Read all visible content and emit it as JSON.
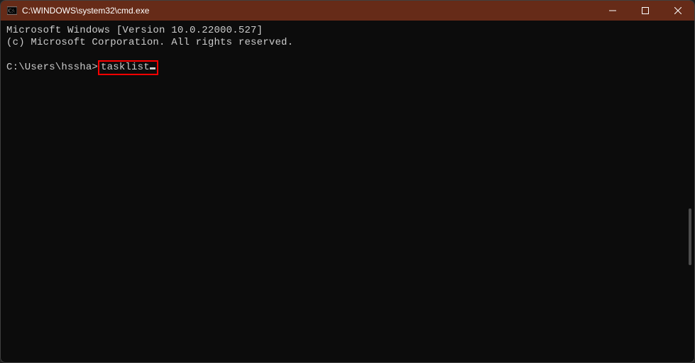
{
  "titlebar": {
    "icon": "cmd-icon",
    "title": "C:\\WINDOWS\\system32\\cmd.exe"
  },
  "controls": {
    "minimize": "minimize",
    "maximize": "maximize",
    "close": "close"
  },
  "terminal": {
    "line1": "Microsoft Windows [Version 10.0.22000.527]",
    "line2": "(c) Microsoft Corporation. All rights reserved.",
    "blank": " ",
    "prompt": "C:\\Users\\hssha>",
    "input": "tasklist"
  }
}
